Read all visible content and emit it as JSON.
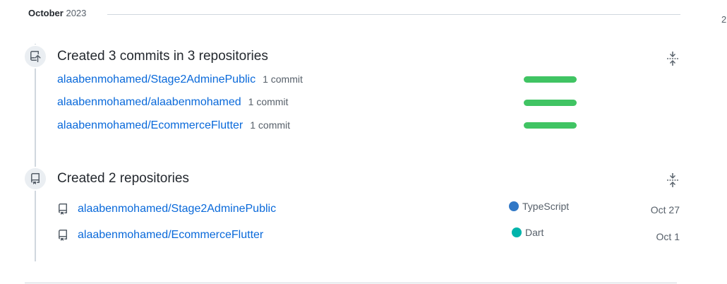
{
  "month": {
    "name": "October",
    "year": "2023"
  },
  "edge_count": "2",
  "commits_section": {
    "title": "Created 3 commits in 3 repositories",
    "icon": "repo-push-icon",
    "rows": [
      {
        "repo": "alaabenmohamed/Stage2AdminePublic",
        "count": "1 commit",
        "fraction": 1.0
      },
      {
        "repo": "alaabenmohamed/alaabenmohamed",
        "count": "1 commit",
        "fraction": 1.0
      },
      {
        "repo": "alaabenmohamed/EcommerceFlutter",
        "count": "1 commit",
        "fraction": 1.0
      }
    ],
    "bar_color": "#40c463"
  },
  "repos_section": {
    "title": "Created 2 repositories",
    "icon": "repo-icon",
    "rows": [
      {
        "repo": "alaabenmohamed/Stage2AdminePublic",
        "language": "TypeScript",
        "language_color": "#3178c6",
        "date": "Oct 27"
      },
      {
        "repo": "alaabenmohamed/EcommerceFlutter",
        "language": "Dart",
        "language_color": "#00b4ab",
        "date": "Oct 1"
      }
    ]
  },
  "colors": {
    "link": "#0969da",
    "muted": "#57606a",
    "line": "#d0d7de"
  }
}
